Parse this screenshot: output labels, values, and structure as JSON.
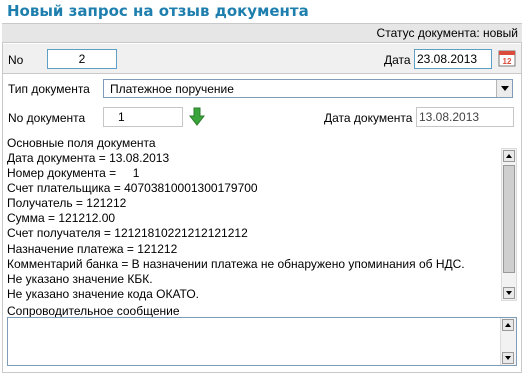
{
  "page": {
    "title": "Новый запрос на отзыв документа"
  },
  "status": {
    "text": "Статус документа: новый"
  },
  "header_row": {
    "no_label": "No",
    "no_value": "2",
    "date_label": "Дата",
    "date_value": "23.08.2013",
    "calendar_icon": "calendar-icon",
    "calendar_day": "12"
  },
  "doc_type": {
    "label": "Тип документа",
    "selected": "Платежное поручение"
  },
  "doc_number": {
    "label": "No документа",
    "value": "1",
    "arrow_icon": "down-arrow-icon"
  },
  "doc_date": {
    "label": "Дата документа",
    "value": "13.08.2013"
  },
  "main_fields": {
    "label": "Основные поля документа",
    "lines": [
      "Дата документа = 13.08.2013",
      "Номер документа =     1",
      "Счет плательщика = 40703810001300179700",
      "Получатель = 121212",
      "Сумма = 121212.00",
      "Счет получателя = 12121810221212121212",
      "Назначение платежа = 121212",
      "Комментарий банка = В назначении платежа не обнаружено упоминания об НДС.",
      "Не указано значение КБК.",
      "Не указано значение кода ОКАТО."
    ]
  },
  "comment": {
    "label": "Сопроводительное сообщение",
    "value": ""
  },
  "colors": {
    "title": "#1e7fae",
    "input_border": "#5f9fc6",
    "arrow_green": "#3aa53a"
  }
}
